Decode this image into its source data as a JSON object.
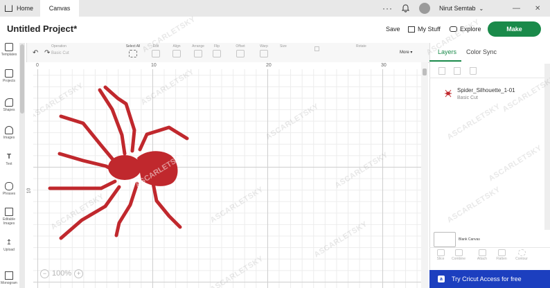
{
  "tabs": {
    "home": "Home",
    "canvas": "Canvas"
  },
  "user": {
    "name": "Nirut Semtab"
  },
  "header": {
    "project_title": "Untitled Project*",
    "save": "Save",
    "my_stuff": "My Stuff",
    "explore": "Explore",
    "make": "Make"
  },
  "toolbar": {
    "operation": "Operation",
    "operation_value": "Basic Cut",
    "select_all": "Select All",
    "edit": "Edit",
    "align": "Align",
    "arrange": "Arrange",
    "flip": "Flip",
    "offset": "Offset",
    "warp": "Warp",
    "size": "Size",
    "rotate": "Rotate",
    "more": "More"
  },
  "sidebar": {
    "items": [
      "Templates",
      "Projects",
      "Shapes",
      "Images",
      "Text",
      "Phrases",
      "Editable Images",
      "Upload",
      "Monogram"
    ]
  },
  "canvas": {
    "ruler_top": [
      "0",
      "10",
      "20",
      "30"
    ],
    "ruler_left": [
      "10"
    ],
    "zoom": "100%",
    "watermark": "ASCARLETSKY",
    "spider_color": "#c0282d"
  },
  "panel": {
    "tab_layers": "Layers",
    "tab_color_sync": "Color Sync",
    "layer_name": "Spider_Silhouette_1-01",
    "layer_op": "Basic Cut",
    "blank_canvas": "Blank Canvas",
    "bottom_tools": [
      "Slice",
      "Combine",
      "Attach",
      "Flatten",
      "Contour"
    ],
    "promo": "Try Cricut Access for free",
    "accent": "#1a8a4a",
    "promo_color": "#1c3fbf"
  }
}
